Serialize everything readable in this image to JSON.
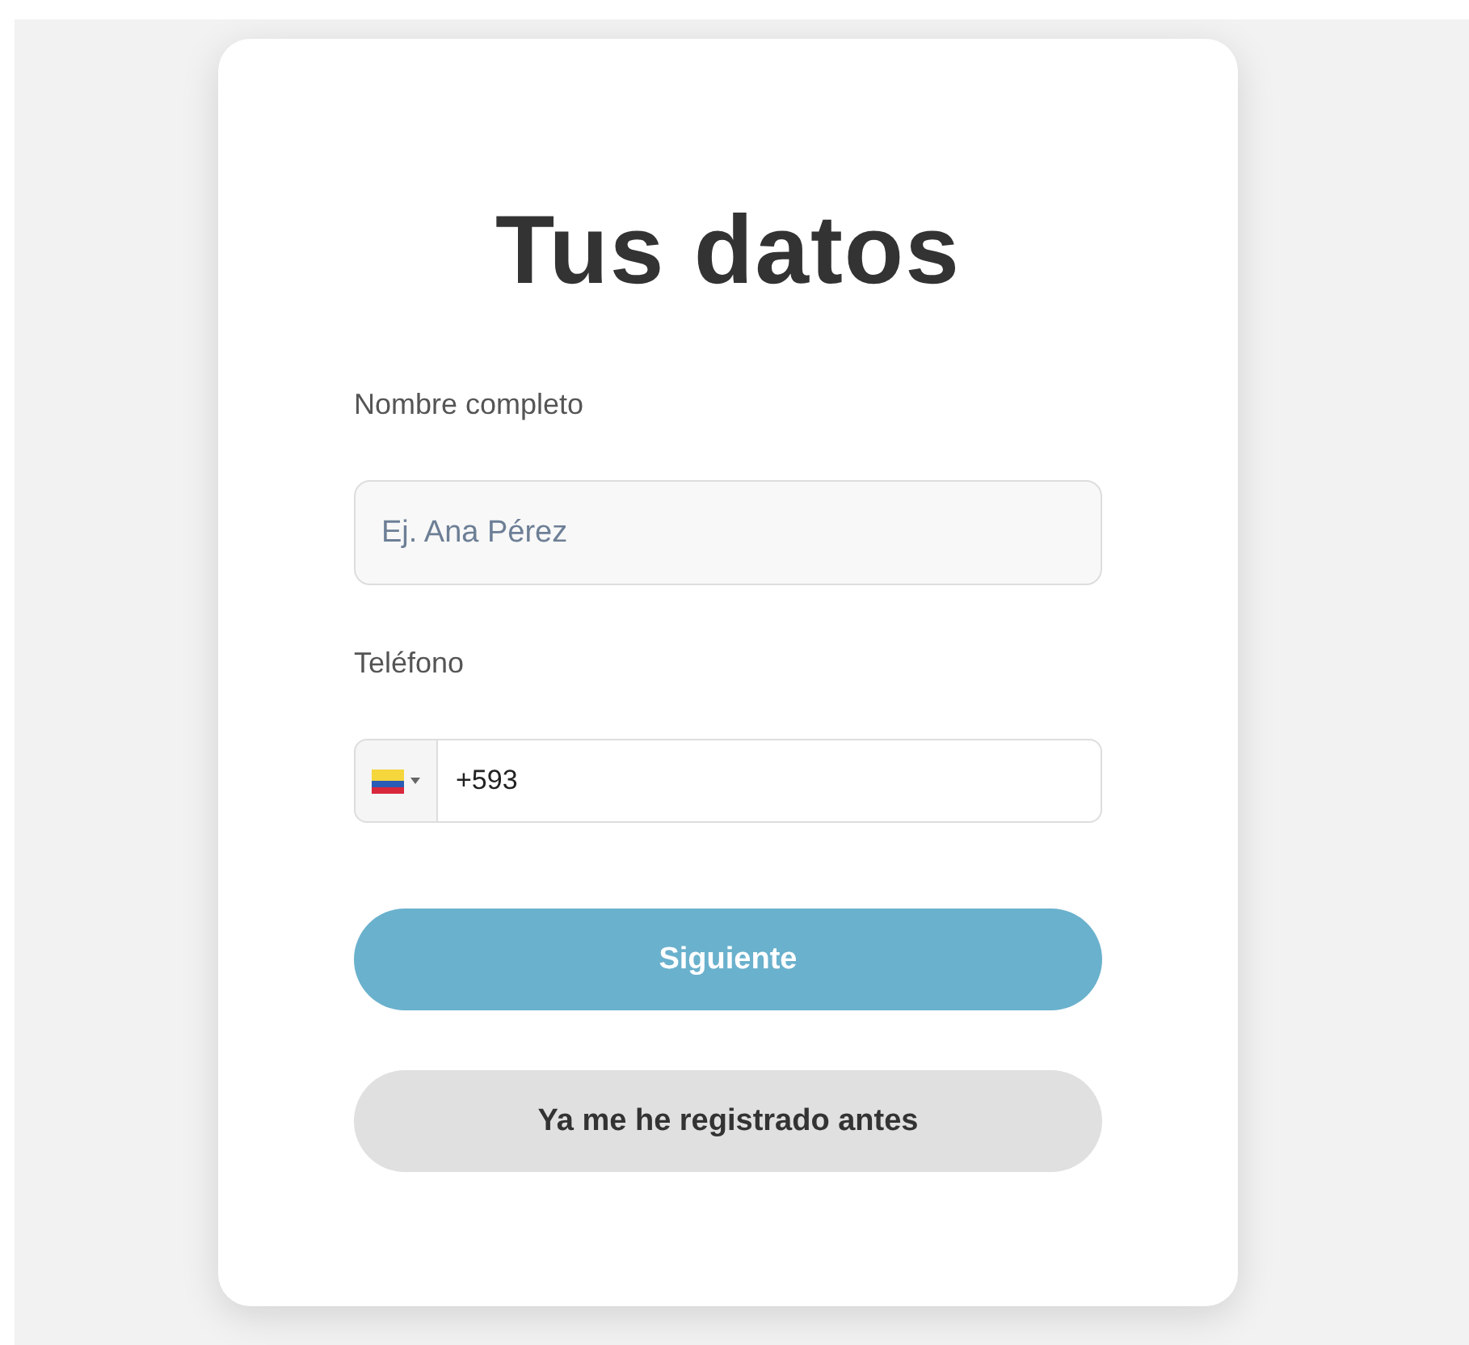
{
  "title": "Tus datos",
  "name_field": {
    "label": "Nombre completo",
    "placeholder": "Ej. Ana Pérez"
  },
  "phone_field": {
    "label": "Teléfono",
    "value": "+593"
  },
  "buttons": [
    {
      "label": "Siguiente",
      "kind": "primary"
    },
    {
      "label": "Ya me he registrado antes",
      "kind": "secondary"
    }
  ]
}
